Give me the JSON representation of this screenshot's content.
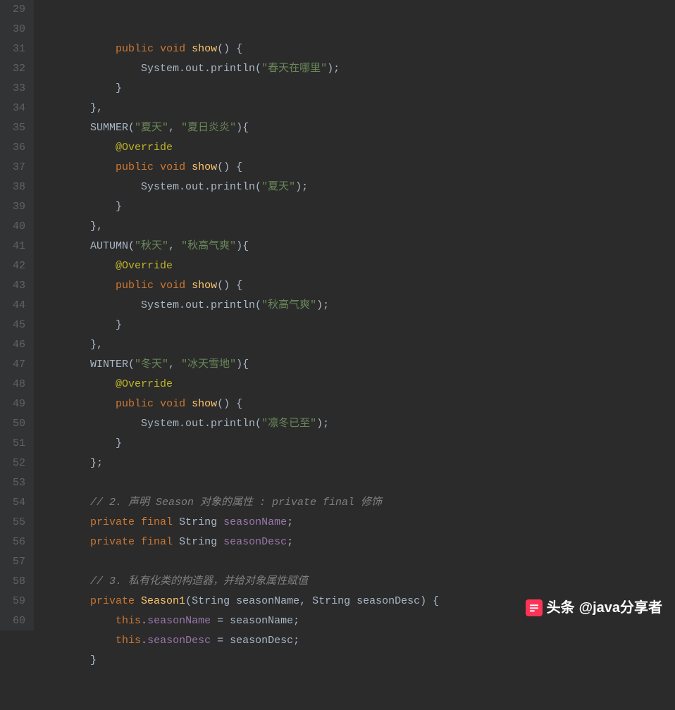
{
  "startLine": 29,
  "endLine": 60,
  "watermark": {
    "prefix": "头条",
    "handle": "@java分享者"
  },
  "lines": [
    {
      "indent": 12,
      "tokens": [
        [
          "kw",
          "public"
        ],
        [
          "punc",
          " "
        ],
        [
          "kw",
          "void"
        ],
        [
          "punc",
          " "
        ],
        [
          "fn",
          "show"
        ],
        [
          "punc",
          "() {"
        ]
      ]
    },
    {
      "indent": 16,
      "tokens": [
        [
          "ident",
          "System.out.println("
        ],
        [
          "str",
          "\"春天在哪里\""
        ],
        [
          "punc",
          ");"
        ]
      ]
    },
    {
      "indent": 12,
      "tokens": [
        [
          "punc",
          "}"
        ]
      ]
    },
    {
      "indent": 8,
      "tokens": [
        [
          "punc",
          "},"
        ]
      ]
    },
    {
      "indent": 8,
      "tokens": [
        [
          "ident",
          "SUMMER("
        ],
        [
          "str",
          "\"夏天\""
        ],
        [
          "punc",
          ", "
        ],
        [
          "str",
          "\"夏日炎炎\""
        ],
        [
          "punc",
          "){"
        ]
      ]
    },
    {
      "indent": 12,
      "tokens": [
        [
          "ann",
          "@Override"
        ]
      ]
    },
    {
      "indent": 12,
      "tokens": [
        [
          "kw",
          "public"
        ],
        [
          "punc",
          " "
        ],
        [
          "kw",
          "void"
        ],
        [
          "punc",
          " "
        ],
        [
          "fn",
          "show"
        ],
        [
          "punc",
          "() {"
        ]
      ]
    },
    {
      "indent": 16,
      "tokens": [
        [
          "ident",
          "System.out.println("
        ],
        [
          "str",
          "\"夏天\""
        ],
        [
          "punc",
          ");"
        ]
      ]
    },
    {
      "indent": 12,
      "tokens": [
        [
          "punc",
          "}"
        ]
      ]
    },
    {
      "indent": 8,
      "tokens": [
        [
          "punc",
          "},"
        ]
      ]
    },
    {
      "indent": 8,
      "tokens": [
        [
          "ident",
          "AUTUMN("
        ],
        [
          "str",
          "\"秋天\""
        ],
        [
          "punc",
          ", "
        ],
        [
          "str",
          "\"秋高气爽\""
        ],
        [
          "punc",
          "){"
        ]
      ]
    },
    {
      "indent": 12,
      "tokens": [
        [
          "ann",
          "@Override"
        ]
      ]
    },
    {
      "indent": 12,
      "tokens": [
        [
          "kw",
          "public"
        ],
        [
          "punc",
          " "
        ],
        [
          "kw",
          "void"
        ],
        [
          "punc",
          " "
        ],
        [
          "fn",
          "show"
        ],
        [
          "punc",
          "() {"
        ]
      ]
    },
    {
      "indent": 16,
      "tokens": [
        [
          "ident",
          "System.out.println("
        ],
        [
          "str",
          "\"秋高气爽\""
        ],
        [
          "punc",
          ");"
        ]
      ]
    },
    {
      "indent": 12,
      "tokens": [
        [
          "punc",
          "}"
        ]
      ]
    },
    {
      "indent": 8,
      "tokens": [
        [
          "punc",
          "},"
        ]
      ]
    },
    {
      "indent": 8,
      "tokens": [
        [
          "ident",
          "WINTER("
        ],
        [
          "str",
          "\"冬天\""
        ],
        [
          "punc",
          ", "
        ],
        [
          "str",
          "\"冰天雪地\""
        ],
        [
          "punc",
          "){"
        ]
      ]
    },
    {
      "indent": 12,
      "tokens": [
        [
          "ann",
          "@Override"
        ]
      ]
    },
    {
      "indent": 12,
      "tokens": [
        [
          "kw",
          "public"
        ],
        [
          "punc",
          " "
        ],
        [
          "kw",
          "void"
        ],
        [
          "punc",
          " "
        ],
        [
          "fn",
          "show"
        ],
        [
          "punc",
          "() {"
        ]
      ]
    },
    {
      "indent": 16,
      "tokens": [
        [
          "ident",
          "System.out.println("
        ],
        [
          "str",
          "\"凛冬已至\""
        ],
        [
          "punc",
          ");"
        ]
      ]
    },
    {
      "indent": 12,
      "tokens": [
        [
          "punc",
          "}"
        ]
      ]
    },
    {
      "indent": 8,
      "tokens": [
        [
          "punc",
          "};"
        ]
      ]
    },
    {
      "indent": 0,
      "tokens": []
    },
    {
      "indent": 8,
      "tokens": [
        [
          "comment",
          "// 2. 声明 Season 对象的属性 : private final 修饰"
        ]
      ]
    },
    {
      "indent": 8,
      "tokens": [
        [
          "kw",
          "private"
        ],
        [
          "punc",
          " "
        ],
        [
          "kw",
          "final"
        ],
        [
          "punc",
          " "
        ],
        [
          "type",
          "String "
        ],
        [
          "field",
          "seasonName"
        ],
        [
          "punc",
          ";"
        ]
      ]
    },
    {
      "indent": 8,
      "tokens": [
        [
          "kw",
          "private"
        ],
        [
          "punc",
          " "
        ],
        [
          "kw",
          "final"
        ],
        [
          "punc",
          " "
        ],
        [
          "type",
          "String "
        ],
        [
          "field",
          "seasonDesc"
        ],
        [
          "punc",
          ";"
        ]
      ]
    },
    {
      "indent": 0,
      "tokens": []
    },
    {
      "indent": 8,
      "tokens": [
        [
          "comment",
          "// 3. 私有化类的构造器，并给对象属性赋值"
        ]
      ]
    },
    {
      "indent": 8,
      "tokens": [
        [
          "kw",
          "private"
        ],
        [
          "punc",
          " "
        ],
        [
          "fn",
          "Season1"
        ],
        [
          "punc",
          "("
        ],
        [
          "type",
          "String "
        ],
        [
          "param",
          "seasonName"
        ],
        [
          "punc",
          ", "
        ],
        [
          "type",
          "String "
        ],
        [
          "param",
          "seasonDesc"
        ],
        [
          "punc",
          ") {"
        ]
      ]
    },
    {
      "indent": 12,
      "tokens": [
        [
          "kw",
          "this"
        ],
        [
          "punc",
          "."
        ],
        [
          "field",
          "seasonName"
        ],
        [
          "punc",
          " = "
        ],
        [
          "param",
          "seasonName"
        ],
        [
          "punc",
          ";"
        ]
      ]
    },
    {
      "indent": 12,
      "tokens": [
        [
          "kw",
          "this"
        ],
        [
          "punc",
          "."
        ],
        [
          "field",
          "seasonDesc"
        ],
        [
          "punc",
          " = "
        ],
        [
          "param",
          "seasonDesc"
        ],
        [
          "punc",
          ";"
        ]
      ]
    },
    {
      "indent": 8,
      "tokens": [
        [
          "punc",
          "}"
        ]
      ]
    }
  ]
}
